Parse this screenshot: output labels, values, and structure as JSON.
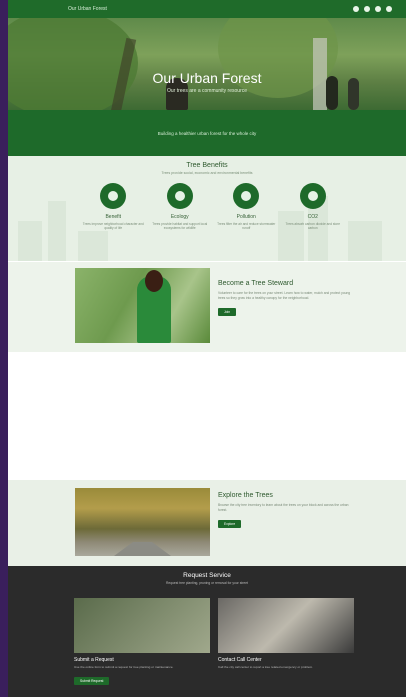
{
  "topbar": {
    "brand": "Our Urban Forest"
  },
  "social": [
    "facebook-icon",
    "twitter-icon",
    "instagram-icon",
    "youtube-icon"
  ],
  "hero": {
    "title": "Our Urban Forest",
    "subtitle": "Our trees are a community resource"
  },
  "mission": {
    "text": "Building a healthier urban forest for the whole city"
  },
  "benefits": {
    "title": "Tree Benefits",
    "subtitle": "Trees provide social, economic and environmental benefits",
    "items": [
      {
        "name": "Benefit",
        "desc": "Trees improve neighborhood character and quality of life",
        "icon": "leaf-icon"
      },
      {
        "name": "Ecology",
        "desc": "Trees provide habitat and support local ecosystems for wildlife",
        "icon": "tree-icon"
      },
      {
        "name": "Pollution",
        "desc": "Trees filter the air and reduce stormwater runoff",
        "icon": "cloud-icon"
      },
      {
        "name": "CO2",
        "desc": "Trees absorb carbon dioxide and store carbon",
        "icon": "tree-icon"
      }
    ]
  },
  "steward": {
    "title": "Become a Tree Steward",
    "body": "Volunteer to care for the trees on your street. Learn how to water, mulch and protect young trees so they grow into a healthy canopy for the neighborhood.",
    "button": "Join"
  },
  "explore": {
    "title": "Explore the Trees",
    "body": "Browse the city tree inventory to learn about the trees on your block and across the urban forest.",
    "button": "Explore"
  },
  "service": {
    "title": "Request Service",
    "subtitle": "Request tree planting, pruning or removal for your street",
    "cards": [
      {
        "name": "Submit a Request",
        "desc": "Use the online form to submit a request for tree planting or maintenance.",
        "button": "Submit Request"
      },
      {
        "name": "Contact Call Center",
        "desc": "Call the city call center to report a tree related emergency or problem.",
        "button": ""
      }
    ]
  },
  "colors": {
    "primary": "#1e6a2a",
    "dark": "#2b2b2b",
    "light": "#e7f0e5"
  }
}
